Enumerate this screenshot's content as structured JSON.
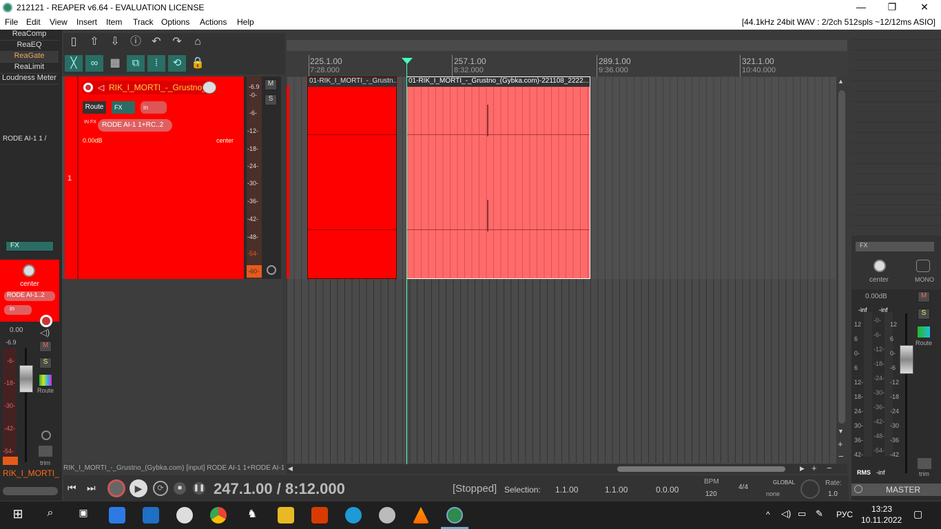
{
  "window": {
    "title": "212121 - REAPER v6.64 - EVALUATION LICENSE",
    "minimize": "—",
    "maximize": "❐",
    "close": "✕"
  },
  "menu": {
    "items": [
      "File",
      "Edit",
      "View",
      "Insert",
      "Item",
      "Track",
      "Options",
      "Actions",
      "Help"
    ],
    "audio_info": "[44.1kHz 24bit WAV : 2/2ch 512spls ~12/12ms ASIO]"
  },
  "fx_chain": [
    "ReaComp",
    "ReaEQ",
    "ReaGate",
    "ReaLimit",
    "Loudness Meter"
  ],
  "mcp_left": {
    "input_label": "RODE AI-1 1 /",
    "fx": "FX",
    "pan": "center",
    "input": "RODE AI-1..2",
    "in": "in",
    "vol": "0.00",
    "peak": "-6.9",
    "db": [
      "-6-",
      "-18-",
      "-30-",
      "-42-",
      "-54-"
    ],
    "track_name": "RIK_I_MORTI_",
    "route": "Route",
    "trim": "trim",
    "m": "M",
    "s": "S"
  },
  "track": {
    "number": "1",
    "name": "RIK_I_MORTI_-_Grustno_",
    "route": "Route",
    "fx": "FX",
    "in": "in",
    "input": "RODE AI-1 1+RC..2",
    "vol": "0.00dB",
    "pan": "center",
    "infx": "IN FX",
    "m": "M",
    "s": "S",
    "meter_peak": "-6.9",
    "meter_marks": [
      "-0-",
      "-6-",
      "-12-",
      "-18-",
      "-24-",
      "-30-",
      "-36-",
      "-42-",
      "-48-",
      "-54-",
      "-60-"
    ]
  },
  "ruler": {
    "marks": [
      {
        "bar": "225.1.00",
        "time": "7:28.000"
      },
      {
        "bar": "257.1.00",
        "time": "8:32.000"
      },
      {
        "bar": "289.1.00",
        "time": "9:36.000"
      },
      {
        "bar": "321.1.00",
        "time": "10:40.000"
      }
    ]
  },
  "items": [
    {
      "name": "01-RIK_I_MORTI_-_Grustn..."
    },
    {
      "name": "01-RIK_I_MORTI_-_Grustno_(Gybka.com)-221108_2222..."
    }
  ],
  "status_line": "RIK_I_MORTI_-_Grustno_(Gybka.com) [input] RODE AI-1 1+RODE AI-1 2",
  "transport": {
    "position": "247.1.00 / 8:12.000",
    "state": "[Stopped]",
    "selection_label": "Selection:",
    "sel_start": "1.1.00",
    "sel_end": "1.1.00",
    "sel_len": "0.0.00",
    "bpm_label": "BPM",
    "bpm": "120",
    "timesig": "4/4",
    "global": "GLOBAL",
    "none": "none",
    "rate_label": "Rate:",
    "rate": "1.0"
  },
  "master": {
    "fx": "FX",
    "pan": "center",
    "mono": "MONO",
    "vol": "0.00dB",
    "inf_l": "-inf",
    "inf_r": "-inf",
    "scale_left": [
      "12",
      "6",
      "0-",
      "6",
      "12-",
      "18-",
      "24-",
      "30-",
      "36-",
      "42-"
    ],
    "scale_mid": [
      "-0-",
      "-6-",
      "-12-",
      "-18-",
      "-24-",
      "-30-",
      "-36-",
      "-42-",
      "-48-",
      "-54-",
      "-60-"
    ],
    "scale_right": [
      "12",
      "6",
      "0-",
      "-6",
      "-12",
      "-18",
      "-24",
      "-30",
      "-36",
      "-42"
    ],
    "m": "M",
    "s": "S",
    "route": "Route",
    "rms": "RMS",
    "rms_val": "-inf",
    "trim": "trim",
    "label": "MASTER"
  },
  "taskbar": {
    "lang": "РУС",
    "time": "13:23",
    "date": "10.11.2022"
  },
  "colors": {
    "track": "#ff0000",
    "item_selected": "#ff6b6b",
    "accent": "#2a6d64"
  }
}
